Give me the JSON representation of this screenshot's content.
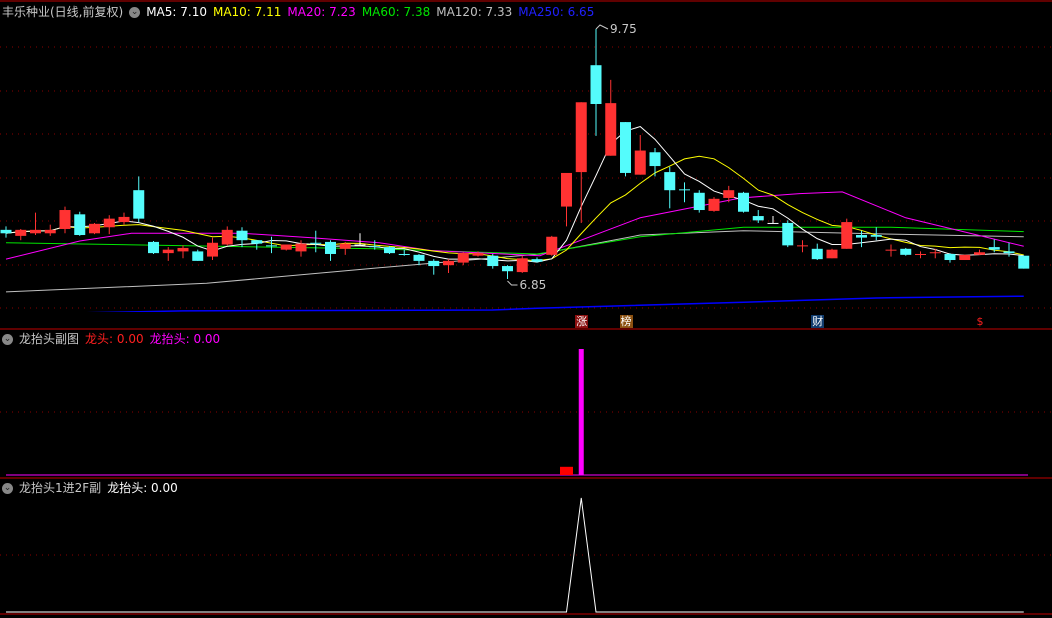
{
  "main": {
    "title": "丰乐种业(日线,前复权)",
    "ma": [
      {
        "label": "MA5: 7.10",
        "color": "#ffffff"
      },
      {
        "label": "MA10: 7.11",
        "color": "#ffff00"
      },
      {
        "label": "MA20: 7.23",
        "color": "#ff00ff"
      },
      {
        "label": "MA60: 7.38",
        "color": "#00e600"
      },
      {
        "label": "MA120: 7.33",
        "color": "#c0c0c0"
      },
      {
        "label": "MA250: 6.65",
        "color": "#0000ff"
      }
    ],
    "high_label": "9.75",
    "low_label": "6.85",
    "markers": [
      {
        "text": "涨",
        "index": 39,
        "bg": "#8b1010",
        "color": "#ffffff"
      },
      {
        "text": "榜",
        "index": 42,
        "bg": "#8b5010",
        "color": "#ffffff"
      },
      {
        "text": "财",
        "index": 55,
        "bg": "#103c6e",
        "color": "#ffffff"
      },
      {
        "text": "$",
        "index": 66,
        "bg": "transparent",
        "color": "#ff2020"
      }
    ]
  },
  "sub1": {
    "title": "龙抬头副图",
    "s1_label": "龙头: 0.00",
    "s2_label": "龙抬头: 0.00"
  },
  "sub2": {
    "title": "龙抬头1进2F副",
    "s1_label": "龙抬头: 0.00"
  },
  "colors": {
    "up": "#ff3232",
    "down": "#54fcfc",
    "grid": "#8a0000",
    "border": "#c00000"
  },
  "chart_data": {
    "type": "candlestick",
    "price_range": [
      6.85,
      9.75
    ],
    "candles": [
      [
        7.42,
        7.46,
        7.33,
        7.38
      ],
      [
        7.35,
        7.43,
        7.3,
        7.42
      ],
      [
        7.38,
        7.62,
        7.36,
        7.42
      ],
      [
        7.38,
        7.48,
        7.35,
        7.42
      ],
      [
        7.43,
        7.69,
        7.38,
        7.65
      ],
      [
        7.6,
        7.63,
        7.35,
        7.36
      ],
      [
        7.38,
        7.5,
        7.37,
        7.49
      ],
      [
        7.45,
        7.59,
        7.37,
        7.55
      ],
      [
        7.51,
        7.62,
        7.48,
        7.57
      ],
      [
        7.88,
        8.04,
        7.51,
        7.55
      ],
      [
        7.28,
        7.29,
        7.14,
        7.15
      ],
      [
        7.15,
        7.22,
        7.06,
        7.19
      ],
      [
        7.17,
        7.24,
        7.09,
        7.21
      ],
      [
        7.17,
        7.19,
        7.06,
        7.06
      ],
      [
        7.11,
        7.33,
        7.07,
        7.27
      ],
      [
        7.25,
        7.46,
        7.24,
        7.42
      ],
      [
        7.41,
        7.45,
        7.22,
        7.3
      ],
      [
        7.3,
        7.3,
        7.19,
        7.26
      ],
      [
        7.24,
        7.34,
        7.15,
        7.23
      ],
      [
        7.19,
        7.25,
        7.18,
        7.25
      ],
      [
        7.17,
        7.3,
        7.11,
        7.26
      ],
      [
        7.27,
        7.41,
        7.16,
        7.26
      ],
      [
        7.28,
        7.3,
        7.06,
        7.14
      ],
      [
        7.2,
        7.28,
        7.13,
        7.26
      ],
      [
        7.25,
        7.38,
        7.24,
        7.25
      ],
      [
        7.23,
        7.3,
        7.19,
        7.22
      ],
      [
        7.22,
        7.23,
        7.14,
        7.15
      ],
      [
        7.14,
        7.19,
        7.12,
        7.13
      ],
      [
        7.13,
        7.14,
        7.01,
        7.06
      ],
      [
        7.06,
        7.08,
        6.9,
        7.0
      ],
      [
        7.01,
        7.08,
        6.92,
        7.06
      ],
      [
        7.04,
        7.16,
        7.01,
        7.15
      ],
      [
        7.12,
        7.17,
        7.11,
        7.15
      ],
      [
        7.12,
        7.14,
        6.97,
        7.0
      ],
      [
        7.0,
        7.01,
        6.85,
        6.94
      ],
      [
        6.93,
        7.12,
        6.92,
        7.09
      ],
      [
        7.08,
        7.1,
        7.04,
        7.05
      ],
      [
        7.13,
        7.35,
        7.12,
        7.34
      ],
      [
        7.69,
        8.08,
        7.46,
        8.08
      ],
      [
        8.09,
        8.9,
        7.5,
        8.9
      ],
      [
        9.33,
        9.75,
        8.51,
        8.88
      ],
      [
        8.28,
        9.16,
        8.28,
        8.89
      ],
      [
        8.67,
        8.67,
        8.04,
        8.08
      ],
      [
        8.06,
        8.52,
        8.06,
        8.34
      ],
      [
        8.32,
        8.37,
        8.04,
        8.16
      ],
      [
        8.09,
        8.15,
        7.67,
        7.88
      ],
      [
        7.89,
        7.97,
        7.74,
        7.88
      ],
      [
        7.85,
        7.88,
        7.62,
        7.65
      ],
      [
        7.64,
        7.8,
        7.63,
        7.78
      ],
      [
        7.79,
        7.93,
        7.74,
        7.88
      ],
      [
        7.85,
        7.86,
        7.62,
        7.63
      ],
      [
        7.58,
        7.65,
        7.5,
        7.53
      ],
      [
        7.5,
        7.58,
        7.5,
        7.5
      ],
      [
        7.5,
        7.53,
        7.22,
        7.24
      ],
      [
        7.23,
        7.3,
        7.16,
        7.24
      ],
      [
        7.2,
        7.26,
        7.07,
        7.08
      ],
      [
        7.09,
        7.2,
        7.09,
        7.19
      ],
      [
        7.2,
        7.55,
        7.2,
        7.51
      ],
      [
        7.36,
        7.41,
        7.22,
        7.33
      ],
      [
        7.36,
        7.45,
        7.3,
        7.34
      ],
      [
        7.18,
        7.25,
        7.11,
        7.19
      ],
      [
        7.2,
        7.21,
        7.12,
        7.13
      ],
      [
        7.13,
        7.17,
        7.09,
        7.14
      ],
      [
        7.15,
        7.2,
        7.09,
        7.16
      ],
      [
        7.14,
        7.15,
        7.04,
        7.07
      ],
      [
        7.07,
        7.13,
        7.07,
        7.13
      ],
      [
        7.13,
        7.19,
        7.13,
        7.16
      ],
      [
        7.22,
        7.31,
        7.16,
        7.19
      ],
      [
        7.17,
        7.27,
        7.11,
        7.15
      ],
      [
        7.12,
        7.12,
        6.97,
        6.97
      ]
    ],
    "ma_knots": {
      "MA20": [
        [
          0,
          7.08
        ],
        [
          5,
          7.29
        ],
        [
          8.5,
          7.38
        ],
        [
          16,
          7.38
        ],
        [
          20.6,
          7.33
        ],
        [
          25.3,
          7.27
        ],
        [
          28.8,
          7.18
        ],
        [
          36.2,
          7.12
        ],
        [
          43,
          7.56
        ],
        [
          49.8,
          7.79
        ],
        [
          53.8,
          7.84
        ],
        [
          56.7,
          7.86
        ],
        [
          61,
          7.56
        ],
        [
          65.6,
          7.37
        ],
        [
          69,
          7.23
        ]
      ],
      "MA60": [
        [
          0,
          7.27
        ],
        [
          25,
          7.2
        ],
        [
          36,
          7.14
        ],
        [
          43,
          7.34
        ],
        [
          50,
          7.45
        ],
        [
          60,
          7.45
        ],
        [
          69,
          7.4
        ]
      ],
      "MA120": [
        [
          0,
          6.7
        ],
        [
          13.6,
          6.8
        ],
        [
          25.3,
          6.98
        ],
        [
          36.2,
          7.14
        ],
        [
          43,
          7.36
        ],
        [
          50,
          7.41
        ],
        [
          60,
          7.37
        ],
        [
          69,
          7.34
        ]
      ],
      "MA250": [
        [
          0,
          6.44
        ],
        [
          12,
          6.48
        ],
        [
          33,
          6.49
        ],
        [
          36,
          6.51
        ],
        [
          50,
          6.58
        ],
        [
          59,
          6.63
        ],
        [
          69,
          6.65
        ]
      ]
    },
    "sub1_series": {
      "龙头": {
        "38": 0.065
      },
      "龙抬头": {
        "39": 1.0
      }
    },
    "sub2_series": {
      "龙抬头": {
        "39": 1.0
      }
    }
  }
}
